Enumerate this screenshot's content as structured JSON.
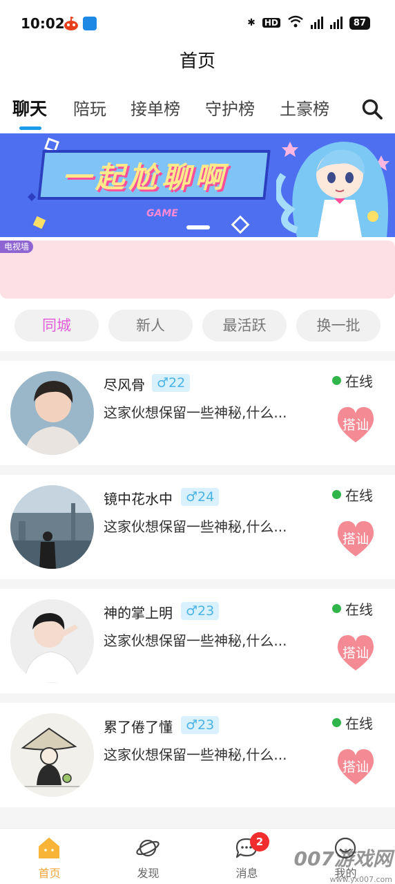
{
  "status_bar": {
    "time": "10:02",
    "right_text": "HD",
    "battery": "87"
  },
  "header": {
    "title": "首页"
  },
  "tabs": [
    {
      "label": "聊天",
      "active": true
    },
    {
      "label": "陪玩"
    },
    {
      "label": "接单榜"
    },
    {
      "label": "守护榜"
    },
    {
      "label": "土豪榜"
    }
  ],
  "banner": {
    "title": "一起尬聊啊",
    "sub": "GAME"
  },
  "tv_wall": {
    "badge": "电视墙"
  },
  "filters": [
    {
      "label": "同城",
      "active": true
    },
    {
      "label": "新人"
    },
    {
      "label": "最活跃"
    },
    {
      "label": "换一批"
    }
  ],
  "users": [
    {
      "name": "尽风骨",
      "age": "♂22",
      "bio": "这家伙想保留一些神秘,什么...",
      "status": "在线",
      "action": "搭讪"
    },
    {
      "name": "镜中花水中",
      "age": "♂24",
      "bio": "这家伙想保留一些神秘,什么...",
      "status": "在线",
      "action": "搭讪"
    },
    {
      "name": "神的掌上明",
      "age": "♂23",
      "bio": "这家伙想保留一些神秘,什么...",
      "status": "在线",
      "action": "搭讪"
    },
    {
      "name": "累了倦了懂",
      "age": "♂23",
      "bio": "这家伙想保留一些神秘,什么...",
      "status": "在线",
      "action": "搭讪"
    }
  ],
  "bottom_nav": [
    {
      "label": "首页",
      "icon": "home-icon",
      "active": true
    },
    {
      "label": "发现",
      "icon": "planet-icon"
    },
    {
      "label": "消息",
      "icon": "chat-bubble-icon",
      "badge": "2"
    },
    {
      "label": "我的",
      "icon": "smile-icon"
    }
  ],
  "watermark": {
    "text": "007游戏网",
    "url": "www.yx007.com"
  },
  "colors": {
    "accent": "#1a9bea",
    "active_filter": "#e25bd9",
    "nav_active": "#f2a53a",
    "greet": "#f48a93",
    "online": "#2fb54a"
  }
}
